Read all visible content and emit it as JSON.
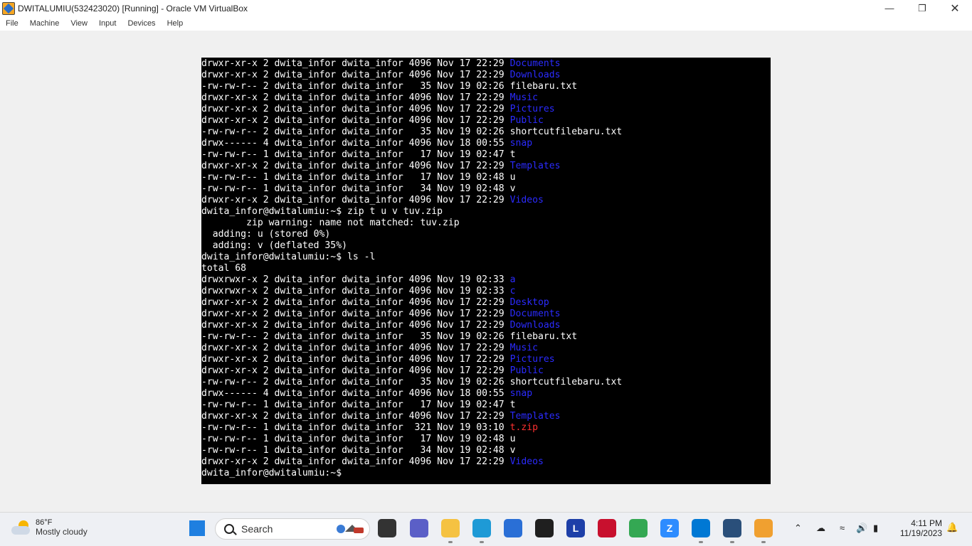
{
  "window": {
    "title": "DWITALUMIU(532423020) [Running] - Oracle VM VirtualBox",
    "controls": [
      "minimize-icon",
      "restore-icon",
      "close-icon"
    ]
  },
  "menu": [
    "File",
    "Machine",
    "View",
    "Input",
    "Devices",
    "Help"
  ],
  "terminal": {
    "lines": [
      {
        "text": "drwxr-xr-x 2 dwita_infor dwita_infor 4096 Nov 17 22:29 ",
        "name": "Documents",
        "type": "dir"
      },
      {
        "text": "drwxr-xr-x 2 dwita_infor dwita_infor 4096 Nov 17 22:29 ",
        "name": "Downloads",
        "type": "dir"
      },
      {
        "text": "-rw-rw-r-- 2 dwita_infor dwita_infor   35 Nov 19 02:26 ",
        "name": "filebaru.txt",
        "type": "file"
      },
      {
        "text": "drwxr-xr-x 2 dwita_infor dwita_infor 4096 Nov 17 22:29 ",
        "name": "Music",
        "type": "dir"
      },
      {
        "text": "drwxr-xr-x 2 dwita_infor dwita_infor 4096 Nov 17 22:29 ",
        "name": "Pictures",
        "type": "dir"
      },
      {
        "text": "drwxr-xr-x 2 dwita_infor dwita_infor 4096 Nov 17 22:29 ",
        "name": "Public",
        "type": "dir"
      },
      {
        "text": "-rw-rw-r-- 2 dwita_infor dwita_infor   35 Nov 19 02:26 ",
        "name": "shortcutfilebaru.txt",
        "type": "file"
      },
      {
        "text": "drwx------ 4 dwita_infor dwita_infor 4096 Nov 18 00:55 ",
        "name": "snap",
        "type": "dir"
      },
      {
        "text": "-rw-rw-r-- 1 dwita_infor dwita_infor   17 Nov 19 02:47 ",
        "name": "t",
        "type": "file"
      },
      {
        "text": "drwxr-xr-x 2 dwita_infor dwita_infor 4096 Nov 17 22:29 ",
        "name": "Templates",
        "type": "dir"
      },
      {
        "text": "-rw-rw-r-- 1 dwita_infor dwita_infor   17 Nov 19 02:48 ",
        "name": "u",
        "type": "file"
      },
      {
        "text": "-rw-rw-r-- 1 dwita_infor dwita_infor   34 Nov 19 02:48 ",
        "name": "v",
        "type": "file"
      },
      {
        "text": "drwxr-xr-x 2 dwita_infor dwita_infor 4096 Nov 17 22:29 ",
        "name": "Videos",
        "type": "dir"
      },
      {
        "text": "dwita_infor@dwitalumiu:~$ zip t u v tuv.zip",
        "name": "",
        "type": "plain"
      },
      {
        "text": "        zip warning: name not matched: tuv.zip",
        "name": "",
        "type": "plain"
      },
      {
        "text": "  adding: u (stored 0%)",
        "name": "",
        "type": "plain"
      },
      {
        "text": "  adding: v (deflated 35%)",
        "name": "",
        "type": "plain"
      },
      {
        "text": "dwita_infor@dwitalumiu:~$ ls -l",
        "name": "",
        "type": "plain"
      },
      {
        "text": "total 68",
        "name": "",
        "type": "plain"
      },
      {
        "text": "drwxrwxr-x 2 dwita_infor dwita_infor 4096 Nov 19 02:33 ",
        "name": "a",
        "type": "dir"
      },
      {
        "text": "drwxrwxr-x 2 dwita_infor dwita_infor 4096 Nov 19 02:33 ",
        "name": "c",
        "type": "dir"
      },
      {
        "text": "drwxr-xr-x 2 dwita_infor dwita_infor 4096 Nov 17 22:29 ",
        "name": "Desktop",
        "type": "dir"
      },
      {
        "text": "drwxr-xr-x 2 dwita_infor dwita_infor 4096 Nov 17 22:29 ",
        "name": "Documents",
        "type": "dir"
      },
      {
        "text": "drwxr-xr-x 2 dwita_infor dwita_infor 4096 Nov 17 22:29 ",
        "name": "Downloads",
        "type": "dir"
      },
      {
        "text": "-rw-rw-r-- 2 dwita_infor dwita_infor   35 Nov 19 02:26 ",
        "name": "filebaru.txt",
        "type": "file"
      },
      {
        "text": "drwxr-xr-x 2 dwita_infor dwita_infor 4096 Nov 17 22:29 ",
        "name": "Music",
        "type": "dir"
      },
      {
        "text": "drwxr-xr-x 2 dwita_infor dwita_infor 4096 Nov 17 22:29 ",
        "name": "Pictures",
        "type": "dir"
      },
      {
        "text": "drwxr-xr-x 2 dwita_infor dwita_infor 4096 Nov 17 22:29 ",
        "name": "Public",
        "type": "dir"
      },
      {
        "text": "-rw-rw-r-- 2 dwita_infor dwita_infor   35 Nov 19 02:26 ",
        "name": "shortcutfilebaru.txt",
        "type": "file"
      },
      {
        "text": "drwx------ 4 dwita_infor dwita_infor 4096 Nov 18 00:55 ",
        "name": "snap",
        "type": "dir"
      },
      {
        "text": "-rw-rw-r-- 1 dwita_infor dwita_infor   17 Nov 19 02:47 ",
        "name": "t",
        "type": "file"
      },
      {
        "text": "drwxr-xr-x 2 dwita_infor dwita_infor 4096 Nov 17 22:29 ",
        "name": "Templates",
        "type": "dir"
      },
      {
        "text": "-rw-rw-r-- 1 dwita_infor dwita_infor  321 Nov 19 03:10 ",
        "name": "t.zip",
        "type": "zip"
      },
      {
        "text": "-rw-rw-r-- 1 dwita_infor dwita_infor   17 Nov 19 02:48 ",
        "name": "u",
        "type": "file"
      },
      {
        "text": "-rw-rw-r-- 1 dwita_infor dwita_infor   34 Nov 19 02:48 ",
        "name": "v",
        "type": "file"
      },
      {
        "text": "drwxr-xr-x 2 dwita_infor dwita_infor 4096 Nov 17 22:29 ",
        "name": "Videos",
        "type": "dir"
      },
      {
        "text": "dwita_infor@dwitalumiu:~$ ",
        "name": "",
        "type": "plain"
      }
    ],
    "colors": {
      "background": "#000000",
      "text": "#ffffff",
      "directory": "#2b2bff",
      "archive": "#ff3030"
    }
  },
  "taskbar": {
    "weather": {
      "temp": "86°F",
      "condition": "Mostly cloudy"
    },
    "search_label": "Search",
    "apps": [
      {
        "name": "task-view-icon",
        "color": "#333333",
        "glyph": ""
      },
      {
        "name": "teams-icon",
        "color": "#5b5fc7",
        "glyph": ""
      },
      {
        "name": "file-explorer-icon",
        "color": "#f5c242",
        "glyph": ""
      },
      {
        "name": "edge-icon",
        "color": "#1e9ad6",
        "glyph": ""
      },
      {
        "name": "store-icon",
        "color": "#2a6fd6",
        "glyph": ""
      },
      {
        "name": "dropbox-icon",
        "color": "#1f1f1f",
        "glyph": ""
      },
      {
        "name": "l-app-icon",
        "color": "#1d3fa8",
        "glyph": "L"
      },
      {
        "name": "mcafee-icon",
        "color": "#c8102e",
        "glyph": ""
      },
      {
        "name": "chrome-icon",
        "color": "#34a853",
        "glyph": ""
      },
      {
        "name": "zoom-icon",
        "color": "#2d8cff",
        "glyph": "Z"
      },
      {
        "name": "vscode-icon",
        "color": "#0078d4",
        "glyph": ""
      },
      {
        "name": "virtualbox-icon",
        "color": "#2a4f7a",
        "glyph": ""
      },
      {
        "name": "virtualbox-vm-icon",
        "color": "#f0a030",
        "glyph": ""
      }
    ],
    "clock": {
      "time": "4:11 PM",
      "date": "11/19/2023"
    }
  }
}
